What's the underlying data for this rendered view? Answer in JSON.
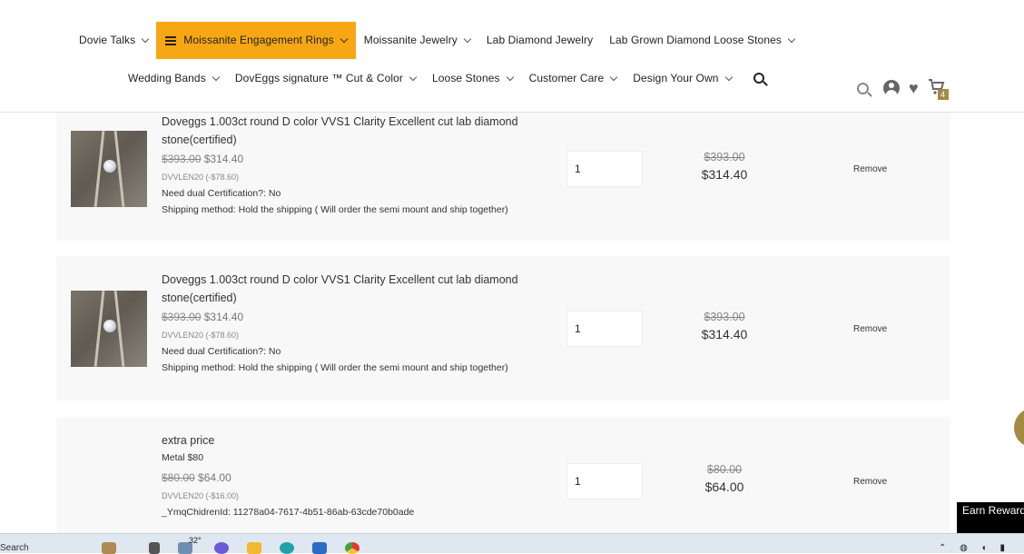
{
  "nav": {
    "row1": [
      {
        "label": "Dovie Talks",
        "chevron": true,
        "active": false
      },
      {
        "label": "Moissanite Engagement Rings",
        "chevron": true,
        "active": true
      },
      {
        "label": "Moissanite Jewelry",
        "chevron": true,
        "active": false
      },
      {
        "label": "Lab Diamond Jewelry",
        "chevron": false,
        "active": false
      },
      {
        "label": "Lab Grown Diamond Loose Stones",
        "chevron": true,
        "active": false
      }
    ],
    "row2": [
      {
        "label": "Wedding Bands",
        "chevron": true
      },
      {
        "label": "DovEggs signature ™ Cut & Color",
        "chevron": true
      },
      {
        "label": "Loose Stones",
        "chevron": true
      },
      {
        "label": "Customer Care",
        "chevron": true
      },
      {
        "label": "Design Your Own",
        "chevron": true
      }
    ],
    "accent_color": "#f6a713"
  },
  "header_tools": {
    "icons": [
      "search-icon",
      "account-icon",
      "heart-icon",
      "cart-icon"
    ],
    "cart_count": "4",
    "badge_color": "#a48a43"
  },
  "cart": {
    "items": [
      {
        "title": "Doveggs 1.003ct round D color VVS1 Clarity Excellent cut lab diamond stone(certified)",
        "old_price": "$393.00",
        "price": "$314.40",
        "discount_code": "DVVLEN20 (-$78.60)",
        "meta": [
          "Need dual Certification?: No",
          "Shipping method: Hold the shipping ( Will order the semi mount and ship together)"
        ],
        "quantity": "1",
        "total_old": "$393.00",
        "total_new": "$314.40",
        "remove_label": "Remove",
        "has_image": true
      },
      {
        "title": "Doveggs 1.003ct round D color VVS1 Clarity Excellent cut lab diamond stone(certified)",
        "old_price": "$393.00",
        "price": "$314.40",
        "discount_code": "DVVLEN20 (-$78.60)",
        "meta": [
          "Need dual Certification?: No",
          "Shipping method: Hold the shipping ( Will order the semi mount and ship together)"
        ],
        "quantity": "1",
        "total_old": "$393.00",
        "total_new": "$314.40",
        "remove_label": "Remove",
        "has_image": true
      },
      {
        "title": "extra price",
        "subtitle": "Metal $80",
        "old_price": "$80.00",
        "price": "$64.00",
        "discount_code": "DVVLEN20 (-$16.00)",
        "meta": [
          "_YmqChidrenId: 11278a04-7617-4b51-86ab-63cde70b0ade"
        ],
        "quantity": "1",
        "total_old": "$80.00",
        "total_new": "$64.00",
        "remove_label": "Remove",
        "has_image": false
      }
    ]
  },
  "widgets": {
    "earn_rewards": "Earn Rewards"
  },
  "taskbar": {
    "search_label": "Search",
    "temperature": "32°"
  }
}
